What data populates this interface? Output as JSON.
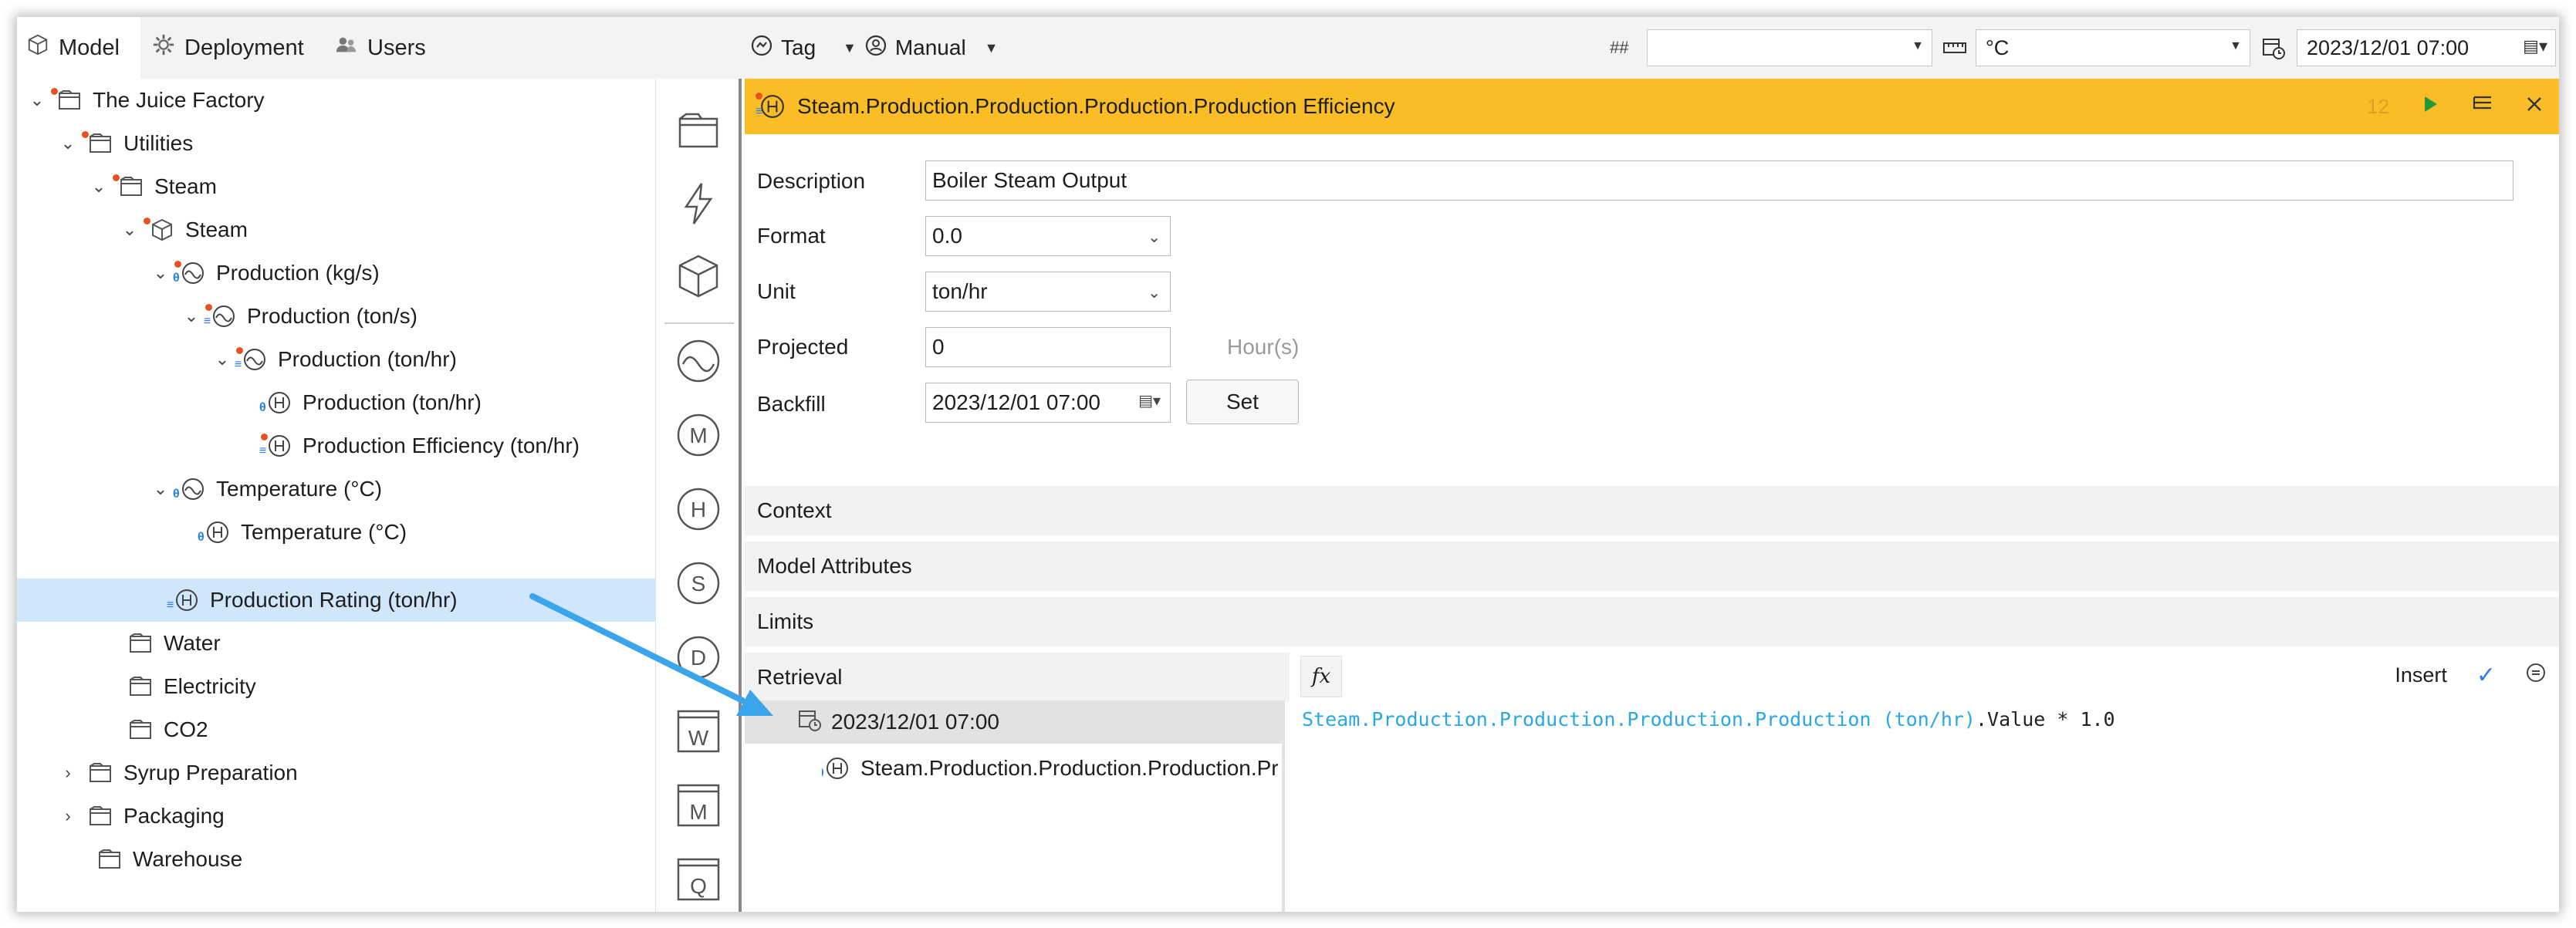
{
  "tabs": [
    {
      "label": "Model",
      "icon": "cube-icon",
      "active": true
    },
    {
      "label": "Deployment",
      "icon": "gear-icon",
      "active": false
    },
    {
      "label": "Users",
      "icon": "users-icon",
      "active": false
    }
  ],
  "toolbar": {
    "tag_label": "Tag",
    "manual_label": "Manual",
    "hash_label": "##",
    "blank_select_value": "",
    "unit_select_value": "°C",
    "datetime_value": "2023/12/01 07:00"
  },
  "tree": {
    "nodes": [
      {
        "label": "The Juice Factory"
      },
      {
        "label": "Utilities"
      },
      {
        "label": "Steam"
      },
      {
        "label": "Steam"
      },
      {
        "label": "Production (kg/s)"
      },
      {
        "label": "Production (ton/s)"
      },
      {
        "label": "Production (ton/hr)"
      },
      {
        "label": "Production (ton/hr)"
      },
      {
        "label": "Production Efficiency (ton/hr)"
      },
      {
        "label": "Temperature (°C)"
      },
      {
        "label": "Temperature (°C)"
      },
      {
        "label": "Production Rating (ton/hr)"
      },
      {
        "label": "Water"
      },
      {
        "label": "Electricity"
      },
      {
        "label": "CO2"
      },
      {
        "label": "Syrup Preparation"
      },
      {
        "label": "Packaging"
      },
      {
        "label": "Warehouse"
      }
    ]
  },
  "rail": {
    "items": [
      "folder-icon",
      "lightning-icon",
      "cube-icon",
      "wave-icon",
      "M",
      "H",
      "S",
      "D",
      "W",
      "M",
      "Q"
    ]
  },
  "detail": {
    "title": "Steam.Production.Production.Production.Production Efficiency",
    "count": "12",
    "form": {
      "description_label": "Description",
      "description_value": "Boiler Steam Output",
      "format_label": "Format",
      "format_value": "0.0",
      "unit_label": "Unit",
      "unit_value": "ton/hr",
      "projected_label": "Projected",
      "projected_value": "0",
      "projected_hint": "Hour(s)",
      "backfill_label": "Backfill",
      "backfill_value": "2023/12/01 07:00",
      "set_label": "Set"
    },
    "sections": {
      "context": "Context",
      "model_attributes": "Model Attributes",
      "limits": "Limits",
      "retrieval": "Retrieval"
    },
    "retrieval": {
      "fx_label": "fx",
      "insert_label": "Insert",
      "check_label": "✓",
      "timestamp": "2023/12/01 07:00",
      "source_tag": "Steam.Production.Production.Production.Pr",
      "expression_ref": "Steam.Production.Production.Production.Production (ton/hr)",
      "expression_rest": ".Value * 1.0"
    }
  },
  "colors": {
    "header": "#fbbd25",
    "selection": "#cfe6fb",
    "arrow": "#3aa5ea",
    "accent_red": "#e8521f",
    "code_ref": "#29a7e6"
  }
}
